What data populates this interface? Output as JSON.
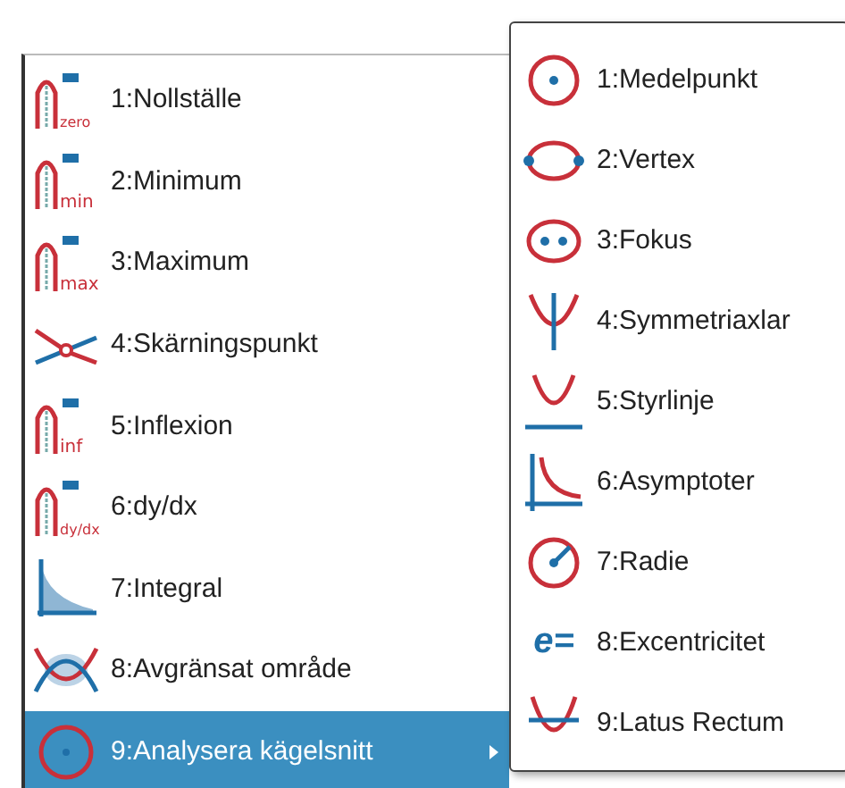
{
  "menu": {
    "items": [
      {
        "label": "1:Nollställe",
        "kind": "graph",
        "icon_label": "zero",
        "selected": false,
        "has_submenu": false
      },
      {
        "label": "2:Minimum",
        "kind": "graph",
        "icon_label": "min",
        "selected": false,
        "has_submenu": false
      },
      {
        "label": "3:Maximum",
        "kind": "graph",
        "icon_label": "max",
        "selected": false,
        "has_submenu": false
      },
      {
        "label": "4:Skärningspunkt",
        "kind": "intersection",
        "selected": false,
        "has_submenu": false
      },
      {
        "label": "5:Inflexion",
        "kind": "graph",
        "icon_label": "inf",
        "selected": false,
        "has_submenu": false
      },
      {
        "label": "6:dy/dx",
        "kind": "graph",
        "icon_label": "dy/dx",
        "selected": false,
        "has_submenu": false
      },
      {
        "label": "7:Integral",
        "kind": "integral",
        "selected": false,
        "has_submenu": false
      },
      {
        "label": "8:Avgränsat område",
        "kind": "bounded",
        "selected": false,
        "has_submenu": false
      },
      {
        "label": "9:Analysera kägelsnitt",
        "kind": "conic",
        "selected": true,
        "has_submenu": true
      }
    ]
  },
  "submenu": {
    "items": [
      {
        "label": "1:Medelpunkt",
        "kind": "center"
      },
      {
        "label": "2:Vertex",
        "kind": "vertex"
      },
      {
        "label": "3:Fokus",
        "kind": "focus"
      },
      {
        "label": "4:Symmetriaxlar",
        "kind": "axis"
      },
      {
        "label": "5:Styrlinje",
        "kind": "directrix"
      },
      {
        "label": "6:Asymptoter",
        "kind": "asymptote"
      },
      {
        "label": "7:Radie",
        "kind": "radius"
      },
      {
        "label": "8:Excentricitet",
        "kind": "glyph",
        "glyph": "e="
      },
      {
        "label": "9:Latus Rectum",
        "kind": "latus"
      }
    ]
  }
}
